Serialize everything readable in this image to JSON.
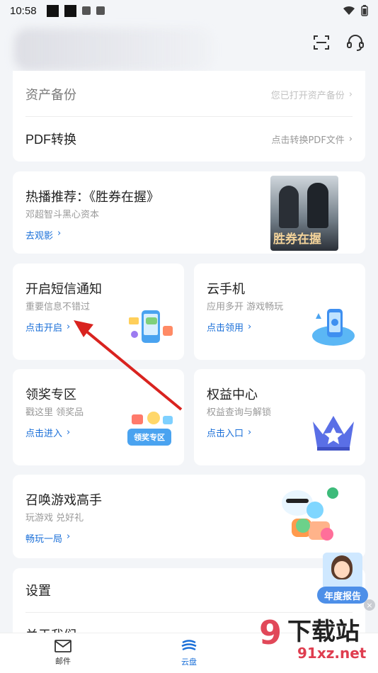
{
  "status": {
    "time": "10:58"
  },
  "menu_top": [
    {
      "title": "资产备份",
      "hint": "您已打开资产备份"
    },
    {
      "title": "PDF转换",
      "hint": "点击转换PDF文件"
    }
  ],
  "hot": {
    "title": "热播推荐：《胜券在握》",
    "subtitle": "邓超智斗黑心资本",
    "link": "去观影",
    "poster_text": "胜券在握"
  },
  "tiles": [
    {
      "title": "开启短信通知",
      "subtitle": "重要信息不错过",
      "link": "点击开启"
    },
    {
      "title": "云手机",
      "subtitle": "应用多开 游戏畅玩",
      "link": "点击领用"
    },
    {
      "title": "领奖专区",
      "subtitle": "戳这里 领奖品",
      "link": "点击进入",
      "badge": "领奖专区"
    },
    {
      "title": "权益中心",
      "subtitle": "权益查询与解锁",
      "link": "点击入口"
    }
  ],
  "game": {
    "title": "召唤游戏高手",
    "subtitle": "玩游戏 兑好礼",
    "link": "畅玩一局"
  },
  "menu_bottom": [
    {
      "title": "设置"
    },
    {
      "title": "关于我们"
    }
  ],
  "annual_report": {
    "label": "年度报告"
  },
  "tabs": [
    {
      "label": "邮件",
      "icon": "mail-icon"
    },
    {
      "label": "云盘",
      "icon": "cloud-icon"
    },
    {
      "label": "",
      "icon": ""
    }
  ],
  "watermark": {
    "brand": "下载站",
    "domain": "91xz.net"
  },
  "colors": {
    "accent": "#1a6fd8",
    "arrow": "#d9231f"
  }
}
